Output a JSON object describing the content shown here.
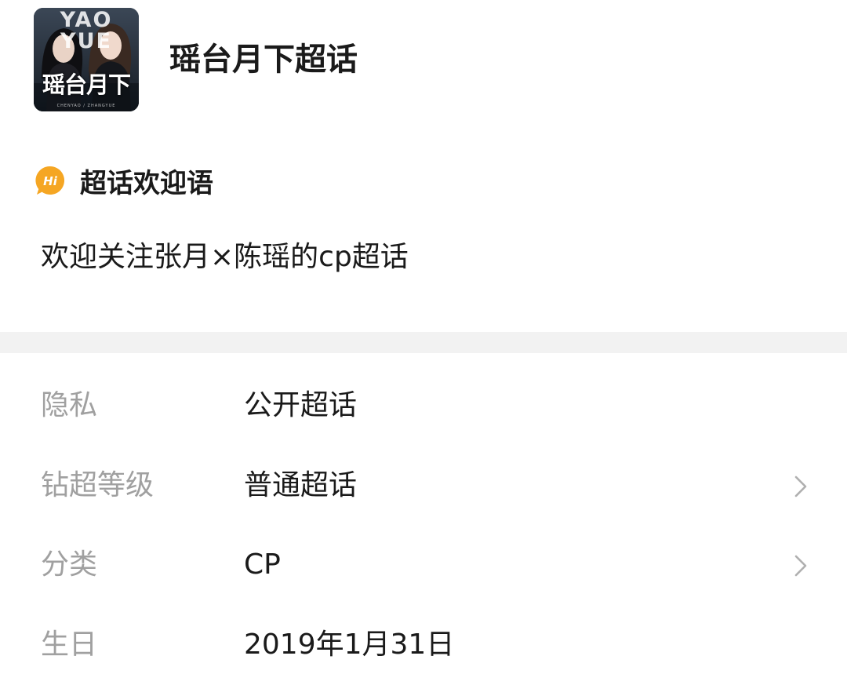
{
  "header": {
    "cover_image": {
      "top_word": "YAO YUE",
      "word": "瑶台月下",
      "credit": "CHENYAO / ZHANGYUE",
      "description": "topic cover avatar"
    },
    "title": "瑶台月下超话"
  },
  "welcome": {
    "icon": "hi-chat-bubble-icon",
    "icon_text": "Hi",
    "icon_color": "#f5a623",
    "title": "超话欢迎语",
    "text": "欢迎关注张月×陈瑶的cp超话"
  },
  "info": {
    "rows": [
      {
        "label": "隐私",
        "value": "公开超话",
        "has_chevron": false
      },
      {
        "label": "钻超等级",
        "value": "普通超话",
        "has_chevron": true,
        "chevron_icon": "chevron-right-icon"
      },
      {
        "label": "分类",
        "value": "CP",
        "has_chevron": true,
        "chevron_icon": "chevron-right-icon"
      },
      {
        "label": "生日",
        "value": "2019年1月31日",
        "has_chevron": false
      }
    ]
  },
  "colors": {
    "text_primary": "#1a1a1a",
    "text_label": "#a0a0a0",
    "divider_band": "#f2f2f2",
    "chevron": "#b0b0b0"
  }
}
